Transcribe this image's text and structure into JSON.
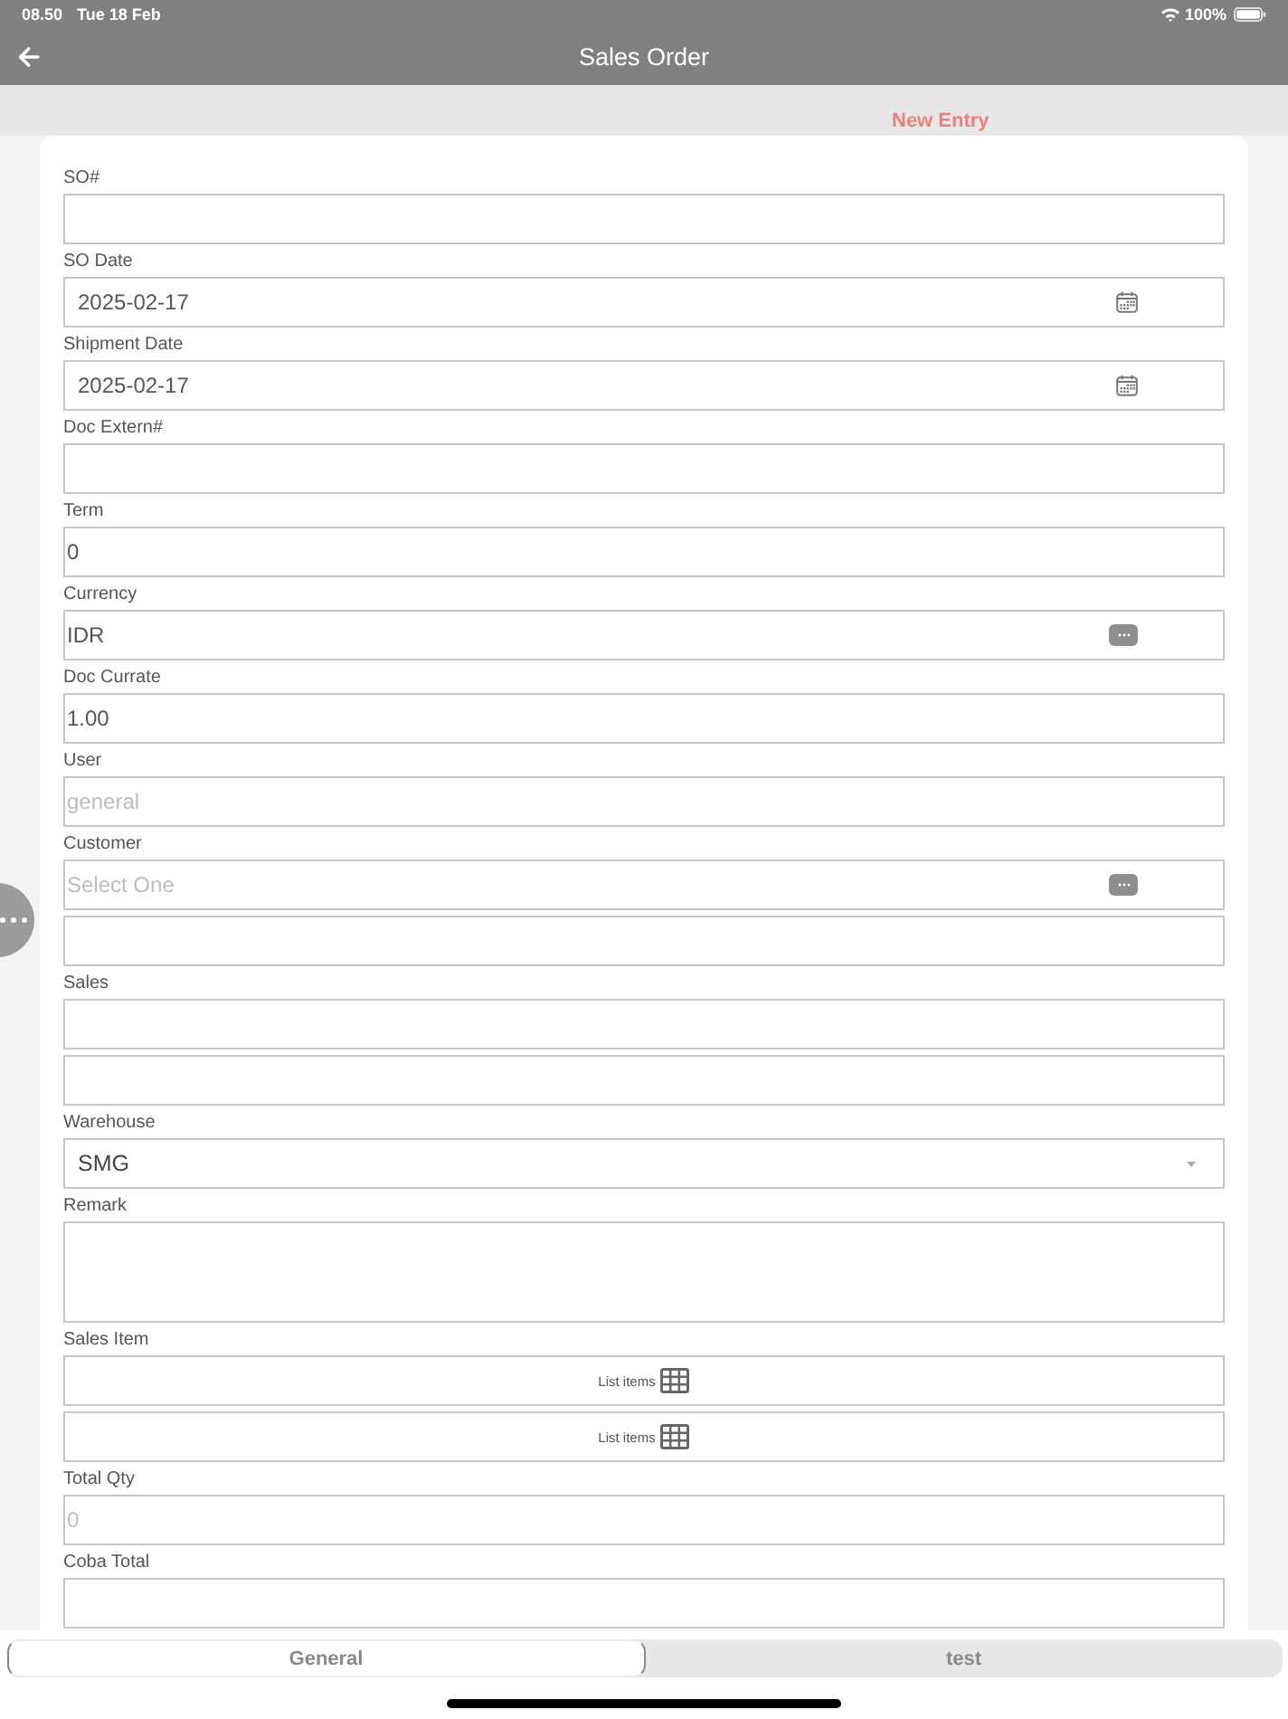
{
  "status_bar": {
    "time": "08.50",
    "date": "Tue 18 Feb",
    "battery": "100%"
  },
  "nav_bar": {
    "title": "Sales Order"
  },
  "entry_mode": "New Entry",
  "fields": [
    {
      "label": "SO#",
      "inputs": [
        {
          "kind": "text"
        }
      ]
    },
    {
      "label": "SO Date",
      "inputs": [
        {
          "kind": "date",
          "value": "2025-02-17"
        }
      ]
    },
    {
      "label": "Shipment Date",
      "inputs": [
        {
          "kind": "date",
          "value": "2025-02-17"
        }
      ]
    },
    {
      "label": "Doc Extern#",
      "inputs": [
        {
          "kind": "text"
        }
      ]
    },
    {
      "label": "Term",
      "inputs": [
        {
          "kind": "text",
          "value": "0"
        }
      ]
    },
    {
      "label": "Currency",
      "inputs": [
        {
          "kind": "lookup",
          "value": "IDR"
        }
      ]
    },
    {
      "label": "Doc Currate",
      "inputs": [
        {
          "kind": "text",
          "value": "1.00"
        }
      ]
    },
    {
      "label": "User",
      "inputs": [
        {
          "kind": "text",
          "placeholder": "general"
        }
      ]
    },
    {
      "label": "Customer",
      "inputs": [
        {
          "kind": "lookup",
          "placeholder": "Select One"
        },
        {
          "kind": "text"
        }
      ]
    },
    {
      "label": "Sales",
      "inputs": [
        {
          "kind": "text"
        },
        {
          "kind": "text"
        }
      ]
    },
    {
      "label": "Warehouse",
      "inputs": [
        {
          "kind": "select",
          "value": "SMG"
        }
      ]
    },
    {
      "label": "Remark",
      "inputs": [
        {
          "kind": "textarea"
        }
      ]
    },
    {
      "label": "Sales Item",
      "inputs": [
        {
          "kind": "list",
          "button": "List items"
        },
        {
          "kind": "list",
          "button": "List items"
        }
      ]
    },
    {
      "label": "Total Qty",
      "inputs": [
        {
          "kind": "text",
          "placeholder": "0"
        }
      ]
    },
    {
      "label": "Coba Total",
      "inputs": [
        {
          "kind": "text"
        }
      ]
    }
  ],
  "tabs": [
    {
      "label": "General",
      "selected": true
    },
    {
      "label": "test",
      "selected": false
    }
  ]
}
